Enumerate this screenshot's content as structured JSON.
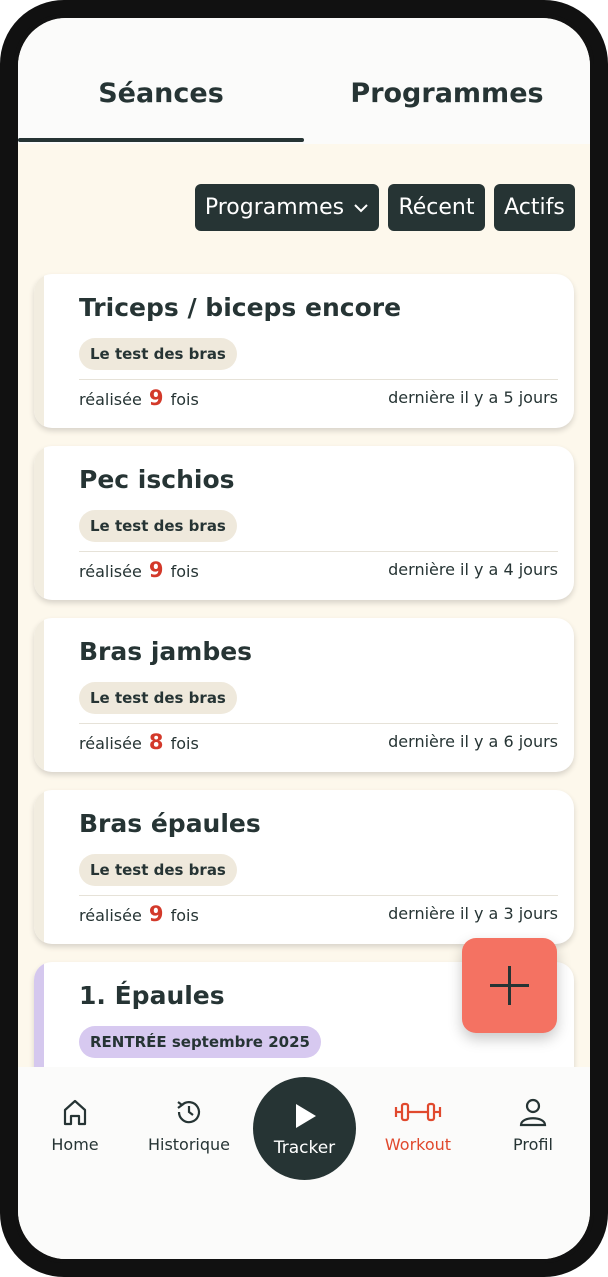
{
  "tabs": {
    "seances": "Séances",
    "programmes": "Programmes"
  },
  "filters": {
    "programmes": "Programmes",
    "recent": "Récent",
    "actifs": "Actifs"
  },
  "cards": [
    {
      "title": "Triceps / biceps encore",
      "tag": "Le test des bras",
      "done_prefix": "réalisée",
      "count": "9",
      "done_suffix": "fois",
      "last": "dernière il y a 5 jours"
    },
    {
      "title": "Pec ischios",
      "tag": "Le test des bras",
      "done_prefix": "réalisée",
      "count": "9",
      "done_suffix": "fois",
      "last": "dernière il y a 4 jours"
    },
    {
      "title": "Bras jambes",
      "tag": "Le test des bras",
      "done_prefix": "réalisée",
      "count": "8",
      "done_suffix": "fois",
      "last": "dernière il y a 6 jours"
    },
    {
      "title": "Bras épaules",
      "tag": "Le test des bras",
      "done_prefix": "réalisée",
      "count": "9",
      "done_suffix": "fois",
      "last": "dernière il y a 3 jours"
    },
    {
      "title": "1. Épaules",
      "tag": "RENTRÉE septembre 2025"
    }
  ],
  "nav": {
    "home": "Home",
    "historique": "Historique",
    "tracker": "Tracker",
    "workout": "Workout",
    "profil": "Profil"
  },
  "colors": {
    "dark": "#263434",
    "accent_red": "#d3392a",
    "fab": "#f47262",
    "background": "#fdf8ec",
    "tag_purple": "#d7c9f0"
  },
  "icons": {
    "fab": "plus-icon",
    "filter_dropdown": "chevron-down-icon"
  }
}
